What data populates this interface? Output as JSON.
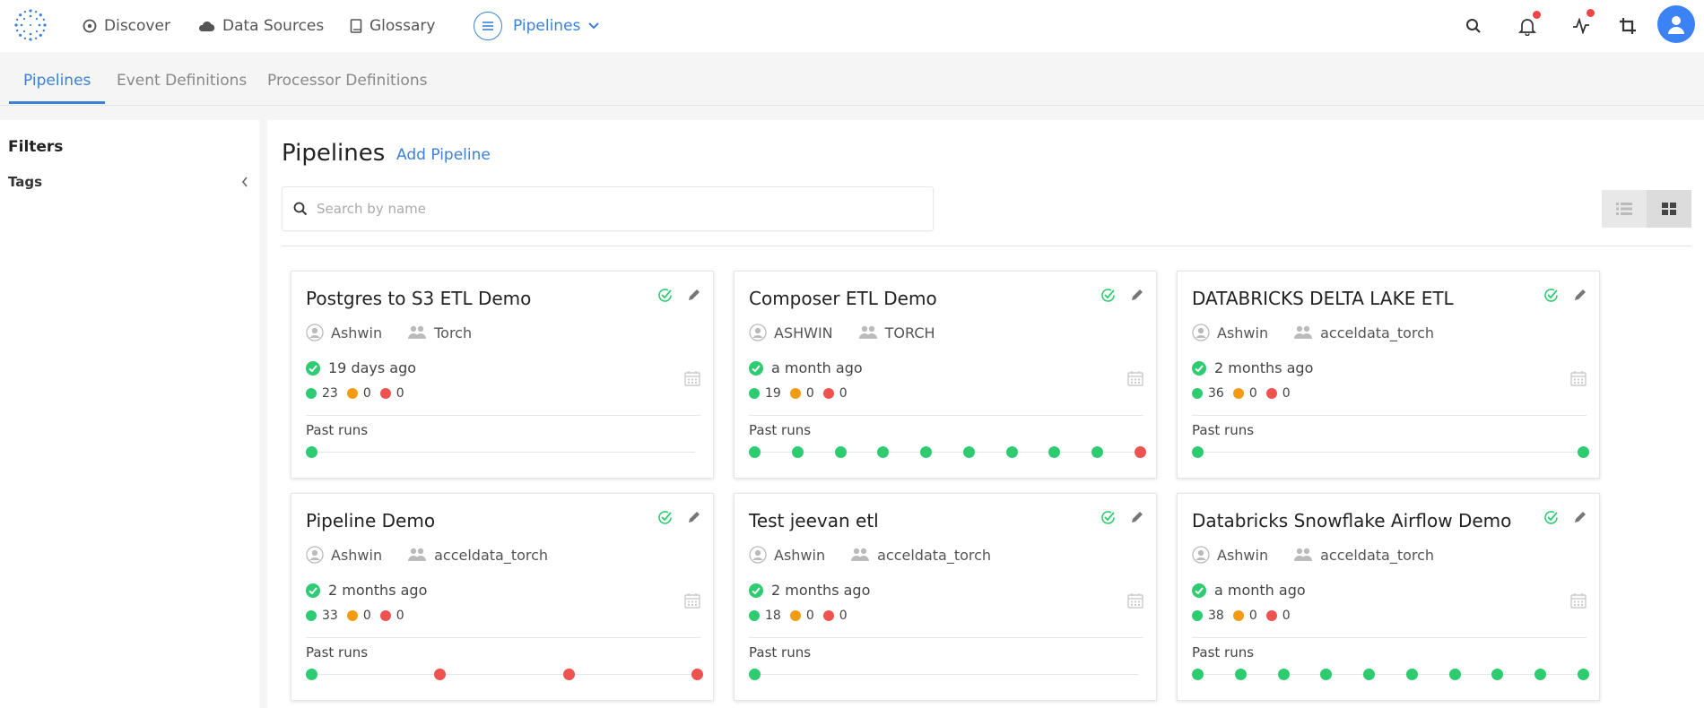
{
  "nav": {
    "items": [
      {
        "label": "Discover",
        "icon": "compass-icon"
      },
      {
        "label": "Data Sources",
        "icon": "cloud-icon"
      },
      {
        "label": "Glossary",
        "icon": "book-icon"
      }
    ],
    "active": {
      "label": "Pipelines",
      "icon": "menu-icon"
    },
    "right_icons": [
      "search-icon",
      "bell-icon",
      "activity-icon",
      "crop-icon",
      "user-icon"
    ],
    "colors": {
      "accent": "#3b82d6",
      "notification": "#ef4444",
      "success": "#2ecc71",
      "warning": "#f39c12",
      "error": "#ef5350"
    }
  },
  "tabs": [
    {
      "label": "Pipelines",
      "active": true
    },
    {
      "label": "Event Definitions",
      "active": false
    },
    {
      "label": "Processor Definitions",
      "active": false
    }
  ],
  "sidebar": {
    "title": "Filters",
    "tags_label": "Tags"
  },
  "main": {
    "title": "Pipelines",
    "add_label": "Add Pipeline",
    "search_placeholder": "Search by name",
    "view_mode": "grid"
  },
  "cards": [
    {
      "title": "Postgres to S3 ETL Demo",
      "owner": "Ashwin",
      "team": "Torch",
      "time": "19 days ago",
      "success": "23",
      "warning": "0",
      "error": "0",
      "past_label": "Past runs",
      "runs": [
        "success"
      ]
    },
    {
      "title": "Composer ETL Demo",
      "owner": "ASHWIN",
      "team": "TORCH",
      "time": "a month ago",
      "success": "19",
      "warning": "0",
      "error": "0",
      "past_label": "Past runs",
      "runs": [
        "success",
        "success",
        "success",
        "success",
        "success",
        "success",
        "success",
        "success",
        "success",
        "failed"
      ]
    },
    {
      "title": "DATABRICKS DELTA LAKE ETL",
      "owner": "Ashwin",
      "team": "acceldata_torch",
      "time": "2 months ago",
      "success": "36",
      "warning": "0",
      "error": "0",
      "past_label": "Past runs",
      "runs": [
        "success",
        "success"
      ]
    },
    {
      "title": "Pipeline Demo",
      "owner": "Ashwin",
      "team": "acceldata_torch",
      "time": "2 months ago",
      "success": "33",
      "warning": "0",
      "error": "0",
      "past_label": "Past runs",
      "runs": [
        "success",
        "failed",
        "failed",
        "failed"
      ]
    },
    {
      "title": "Test jeevan etl",
      "owner": "Ashwin",
      "team": "acceldata_torch",
      "time": "2 months ago",
      "success": "18",
      "warning": "0",
      "error": "0",
      "past_label": "Past runs",
      "runs": [
        "success"
      ]
    },
    {
      "title": "Databricks Snowflake Airflow Demo",
      "owner": "Ashwin",
      "team": "acceldata_torch",
      "time": "a month ago",
      "success": "38",
      "warning": "0",
      "error": "0",
      "past_label": "Past runs",
      "runs": [
        "success",
        "success",
        "success",
        "success",
        "success",
        "success",
        "success",
        "success",
        "success",
        "success"
      ]
    }
  ]
}
